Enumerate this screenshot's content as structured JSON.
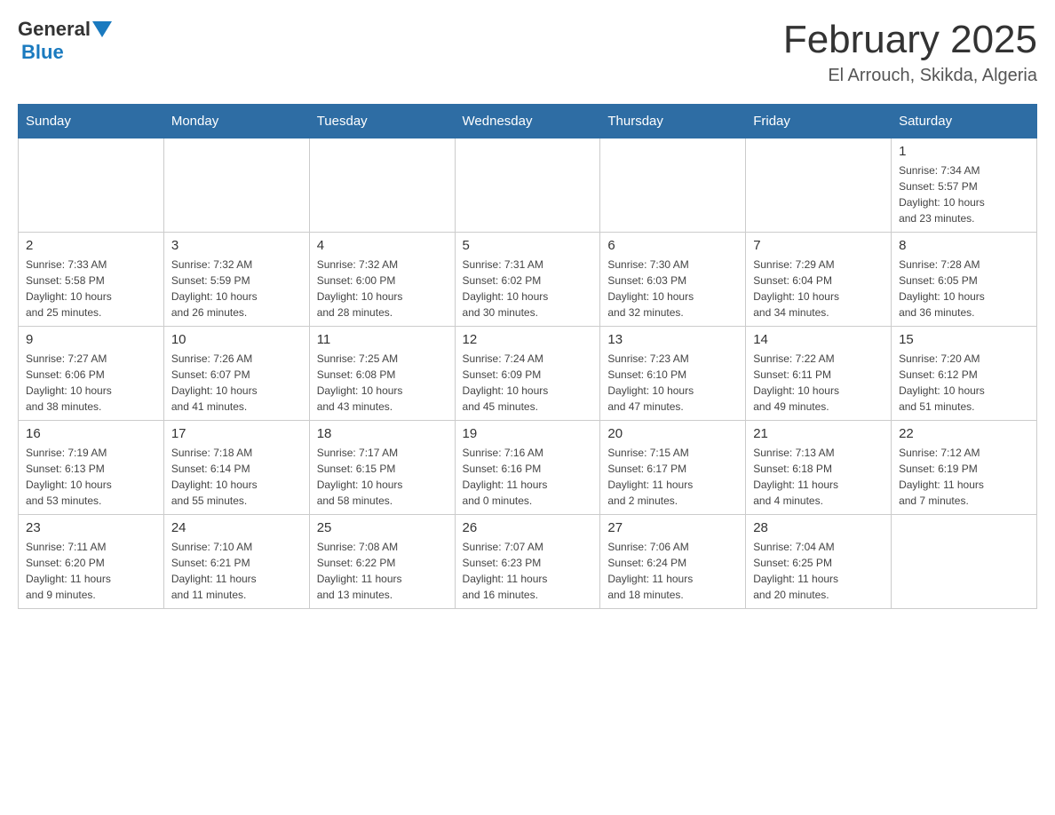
{
  "header": {
    "logo_general": "General",
    "logo_blue": "Blue",
    "month_title": "February 2025",
    "location": "El Arrouch, Skikda, Algeria"
  },
  "weekdays": [
    "Sunday",
    "Monday",
    "Tuesday",
    "Wednesday",
    "Thursday",
    "Friday",
    "Saturday"
  ],
  "weeks": [
    [
      {
        "day": "",
        "info": ""
      },
      {
        "day": "",
        "info": ""
      },
      {
        "day": "",
        "info": ""
      },
      {
        "day": "",
        "info": ""
      },
      {
        "day": "",
        "info": ""
      },
      {
        "day": "",
        "info": ""
      },
      {
        "day": "1",
        "info": "Sunrise: 7:34 AM\nSunset: 5:57 PM\nDaylight: 10 hours\nand 23 minutes."
      }
    ],
    [
      {
        "day": "2",
        "info": "Sunrise: 7:33 AM\nSunset: 5:58 PM\nDaylight: 10 hours\nand 25 minutes."
      },
      {
        "day": "3",
        "info": "Sunrise: 7:32 AM\nSunset: 5:59 PM\nDaylight: 10 hours\nand 26 minutes."
      },
      {
        "day": "4",
        "info": "Sunrise: 7:32 AM\nSunset: 6:00 PM\nDaylight: 10 hours\nand 28 minutes."
      },
      {
        "day": "5",
        "info": "Sunrise: 7:31 AM\nSunset: 6:02 PM\nDaylight: 10 hours\nand 30 minutes."
      },
      {
        "day": "6",
        "info": "Sunrise: 7:30 AM\nSunset: 6:03 PM\nDaylight: 10 hours\nand 32 minutes."
      },
      {
        "day": "7",
        "info": "Sunrise: 7:29 AM\nSunset: 6:04 PM\nDaylight: 10 hours\nand 34 minutes."
      },
      {
        "day": "8",
        "info": "Sunrise: 7:28 AM\nSunset: 6:05 PM\nDaylight: 10 hours\nand 36 minutes."
      }
    ],
    [
      {
        "day": "9",
        "info": "Sunrise: 7:27 AM\nSunset: 6:06 PM\nDaylight: 10 hours\nand 38 minutes."
      },
      {
        "day": "10",
        "info": "Sunrise: 7:26 AM\nSunset: 6:07 PM\nDaylight: 10 hours\nand 41 minutes."
      },
      {
        "day": "11",
        "info": "Sunrise: 7:25 AM\nSunset: 6:08 PM\nDaylight: 10 hours\nand 43 minutes."
      },
      {
        "day": "12",
        "info": "Sunrise: 7:24 AM\nSunset: 6:09 PM\nDaylight: 10 hours\nand 45 minutes."
      },
      {
        "day": "13",
        "info": "Sunrise: 7:23 AM\nSunset: 6:10 PM\nDaylight: 10 hours\nand 47 minutes."
      },
      {
        "day": "14",
        "info": "Sunrise: 7:22 AM\nSunset: 6:11 PM\nDaylight: 10 hours\nand 49 minutes."
      },
      {
        "day": "15",
        "info": "Sunrise: 7:20 AM\nSunset: 6:12 PM\nDaylight: 10 hours\nand 51 minutes."
      }
    ],
    [
      {
        "day": "16",
        "info": "Sunrise: 7:19 AM\nSunset: 6:13 PM\nDaylight: 10 hours\nand 53 minutes."
      },
      {
        "day": "17",
        "info": "Sunrise: 7:18 AM\nSunset: 6:14 PM\nDaylight: 10 hours\nand 55 minutes."
      },
      {
        "day": "18",
        "info": "Sunrise: 7:17 AM\nSunset: 6:15 PM\nDaylight: 10 hours\nand 58 minutes."
      },
      {
        "day": "19",
        "info": "Sunrise: 7:16 AM\nSunset: 6:16 PM\nDaylight: 11 hours\nand 0 minutes."
      },
      {
        "day": "20",
        "info": "Sunrise: 7:15 AM\nSunset: 6:17 PM\nDaylight: 11 hours\nand 2 minutes."
      },
      {
        "day": "21",
        "info": "Sunrise: 7:13 AM\nSunset: 6:18 PM\nDaylight: 11 hours\nand 4 minutes."
      },
      {
        "day": "22",
        "info": "Sunrise: 7:12 AM\nSunset: 6:19 PM\nDaylight: 11 hours\nand 7 minutes."
      }
    ],
    [
      {
        "day": "23",
        "info": "Sunrise: 7:11 AM\nSunset: 6:20 PM\nDaylight: 11 hours\nand 9 minutes."
      },
      {
        "day": "24",
        "info": "Sunrise: 7:10 AM\nSunset: 6:21 PM\nDaylight: 11 hours\nand 11 minutes."
      },
      {
        "day": "25",
        "info": "Sunrise: 7:08 AM\nSunset: 6:22 PM\nDaylight: 11 hours\nand 13 minutes."
      },
      {
        "day": "26",
        "info": "Sunrise: 7:07 AM\nSunset: 6:23 PM\nDaylight: 11 hours\nand 16 minutes."
      },
      {
        "day": "27",
        "info": "Sunrise: 7:06 AM\nSunset: 6:24 PM\nDaylight: 11 hours\nand 18 minutes."
      },
      {
        "day": "28",
        "info": "Sunrise: 7:04 AM\nSunset: 6:25 PM\nDaylight: 11 hours\nand 20 minutes."
      },
      {
        "day": "",
        "info": ""
      }
    ]
  ]
}
